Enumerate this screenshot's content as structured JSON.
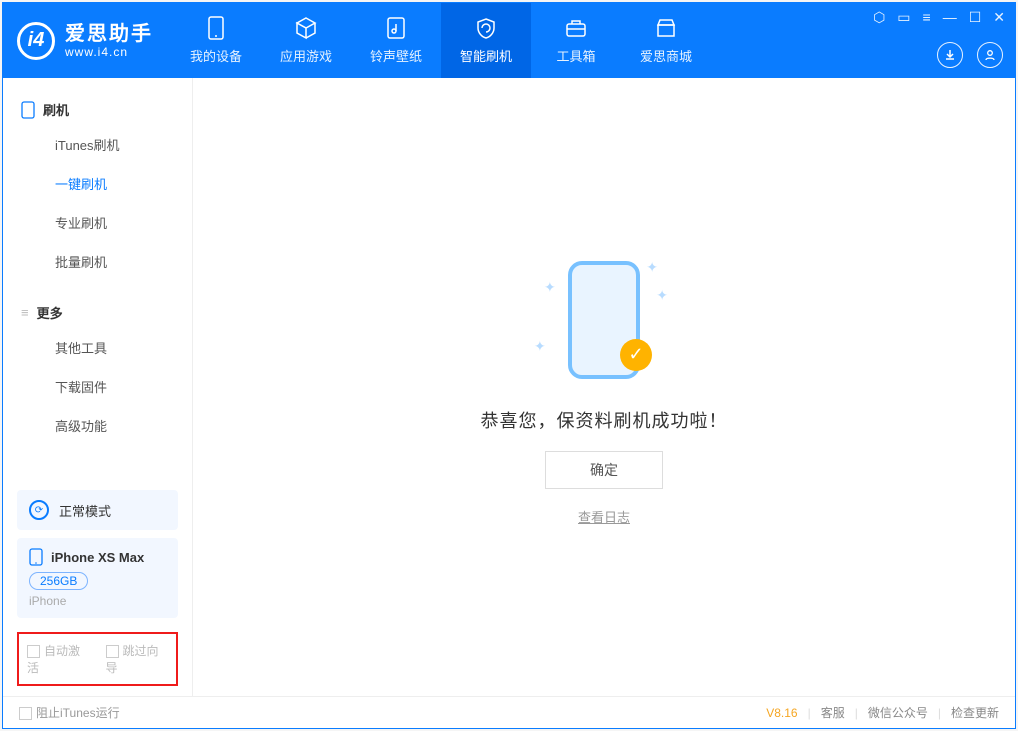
{
  "app": {
    "name": "爱思助手",
    "site": "www.i4.cn"
  },
  "nav": {
    "my_device": "我的设备",
    "apps_games": "应用游戏",
    "ringtones_wallpapers": "铃声壁纸",
    "smart_flash": "智能刷机",
    "toolbox": "工具箱",
    "store": "爱思商城"
  },
  "sidebar": {
    "group_flash": "刷机",
    "items_flash": {
      "itunes_flash": "iTunes刷机",
      "one_click_flash": "一键刷机",
      "pro_flash": "专业刷机",
      "batch_flash": "批量刷机"
    },
    "group_more": "更多",
    "items_more": {
      "other_tools": "其他工具",
      "download_firmware": "下载固件",
      "advanced": "高级功能"
    },
    "mode_label": "正常模式",
    "device": {
      "name": "iPhone XS Max",
      "capacity": "256GB",
      "type": "iPhone"
    },
    "checkbox_auto_activate": "自动激活",
    "checkbox_skip_guide": "跳过向导"
  },
  "main": {
    "success_message": "恭喜您，保资料刷机成功啦！",
    "ok_button": "确定",
    "view_log": "查看日志"
  },
  "footer": {
    "block_itunes": "阻止iTunes运行",
    "version": "V8.16",
    "support": "客服",
    "wechat": "微信公众号",
    "check_update": "检查更新"
  }
}
